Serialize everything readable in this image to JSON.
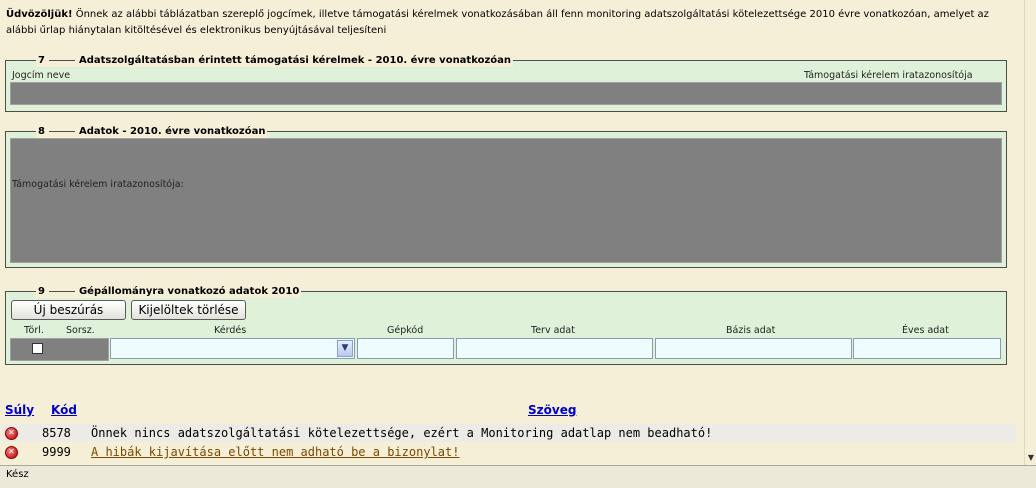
{
  "intro": {
    "bold": "Üdvözöljük!",
    "text": " Önnek az alábbi táblázatban szereplő jogcímek, illetve támogatási kérelmek vonatkozásában áll fenn monitoring adatszolgáltatási kötelezettsége 2010 évre vonatkozóan, amelyet az alábbi űrlap hiánytalan kitöltésével és elektronikus benyújtásával teljesíteni"
  },
  "sections": {
    "s7": {
      "number": "7",
      "title": "Adatszolgáltatásban érintett támogatási kérelmek - 2010. évre vonatkozóan",
      "col1": "Jogcím neve",
      "col2": "Támogatási kérelem iratazonosítója"
    },
    "s8": {
      "number": "8",
      "title": "Adatok - 2010. évre vonatkozóan",
      "field_label": "Támogatási kérelem iratazonosítója:"
    },
    "s9": {
      "number": "9",
      "title": "Gépállományra vonatkozó adatok 2010",
      "insert_button": "Új beszúrás",
      "delete_button": "Kijelöltek törlése",
      "columns": {
        "torl": "Törl.",
        "sorsz": "Sorsz.",
        "kerdes": "Kérdés",
        "gepkod": "Gépkód",
        "terv": "Terv adat",
        "bazis": "Bázis adat",
        "eves": "Éves adat"
      }
    }
  },
  "messages": {
    "headers": {
      "suly": "Súly",
      "kod": "Kód",
      "szoveg": "Szöveg"
    },
    "rows": [
      {
        "code": "8578",
        "text": "Önnek nincs adatszolgáltatási kötelezettsége, ezért a Monitoring adatlap nem beadható!"
      },
      {
        "code": "9999",
        "text": "A hibák kijavítása előtt nem adható be a bizonylat!"
      }
    ]
  },
  "status": "Kész",
  "colors": {
    "panel": "#dff2d9",
    "grey": "#808080",
    "link": "#0000c8",
    "error": "#c00000"
  }
}
